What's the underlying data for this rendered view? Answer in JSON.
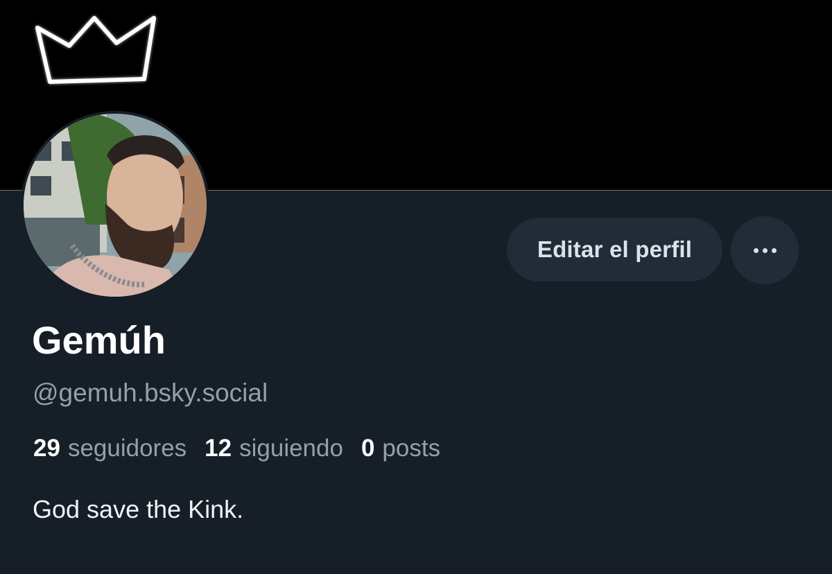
{
  "banner": {
    "icon": "crown-icon",
    "background": "#000000"
  },
  "avatar": {
    "description_icon": "avatar"
  },
  "actions": {
    "edit_label": "Editar el perfil",
    "more_icon": "more-horizontal-icon"
  },
  "profile": {
    "display_name": "Gemúh",
    "handle": "@gemuh.bsky.social",
    "bio": "God save the Kink."
  },
  "stats": {
    "followers_count": "29",
    "followers_label": "seguidores",
    "following_count": "12",
    "following_label": "siguiendo",
    "posts_count": "0",
    "posts_label": "posts"
  },
  "colors": {
    "page_bg": "#161e27",
    "button_bg": "#212c38",
    "muted_text": "#94a0ad",
    "primary_text": "#ffffff"
  }
}
